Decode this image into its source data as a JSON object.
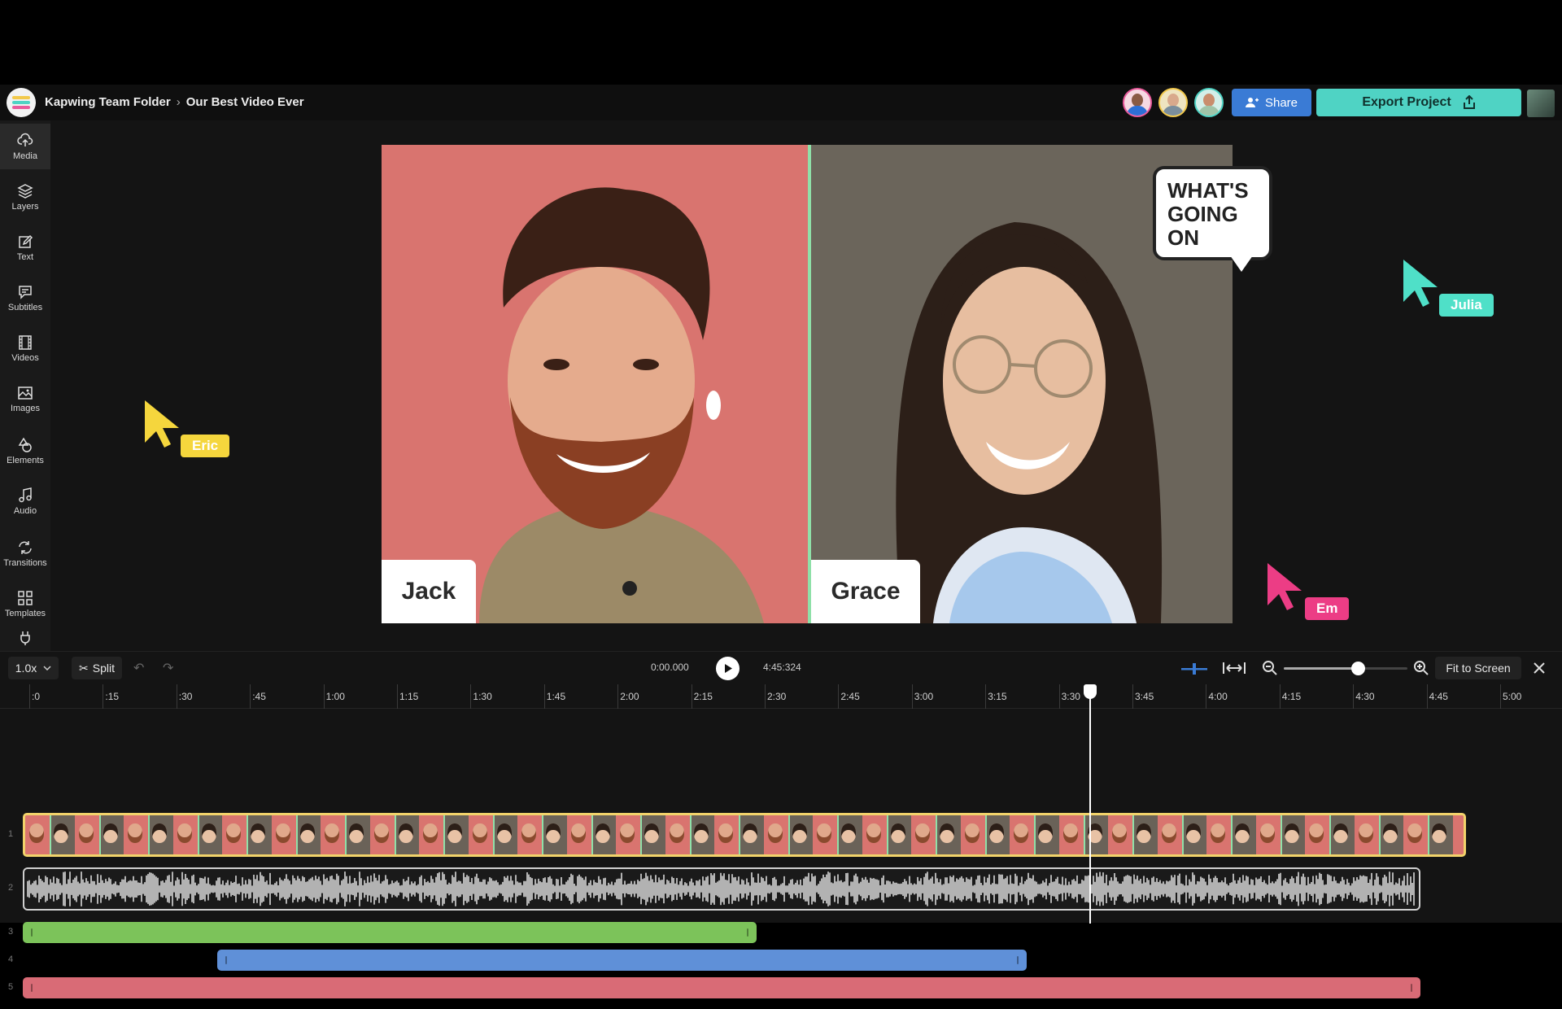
{
  "topbar": {
    "folder": "Kapwing Team Folder",
    "separator": "›",
    "project_title": "Our Best Video Ever",
    "share_label": "Share",
    "export_label": "Export Project",
    "collaborators": [
      {
        "name": "collaborator-1",
        "color": "#e85a9b",
        "body": "#2d6fd6"
      },
      {
        "name": "collaborator-2",
        "color": "#f2c94c",
        "body": "#7b8e9c"
      },
      {
        "name": "collaborator-3",
        "color": "#4fd3c4",
        "body": "#a0c4a8"
      }
    ]
  },
  "sidebar": {
    "items": [
      {
        "label": "Media",
        "icon": "upload-icon"
      },
      {
        "label": "Layers",
        "icon": "layers-icon"
      },
      {
        "label": "Text",
        "icon": "pencil-icon"
      },
      {
        "label": "Subtitles",
        "icon": "subtitles-icon"
      },
      {
        "label": "Videos",
        "icon": "film-icon"
      },
      {
        "label": "Images",
        "icon": "image-icon"
      },
      {
        "label": "Elements",
        "icon": "shapes-icon"
      },
      {
        "label": "Audio",
        "icon": "music-icon"
      },
      {
        "label": "Transitions",
        "icon": "transition-icon"
      },
      {
        "label": "Templates",
        "icon": "grid-icon"
      },
      {
        "label": "",
        "icon": "plugin-icon"
      }
    ]
  },
  "canvas": {
    "left_name": "Jack",
    "right_name": "Grace",
    "speech_bubble": [
      "WHAT'S",
      "GOING",
      "ON"
    ]
  },
  "cursors": [
    {
      "name": "Eric",
      "color": "#f5d63d"
    },
    {
      "name": "Julia",
      "color": "#4fe0c8"
    },
    {
      "name": "Em",
      "color": "#ec3d85"
    }
  ],
  "timeline": {
    "speed": "1.0x",
    "split_label": "Split",
    "current_time": "0:00.000",
    "total_time": "4:45:324",
    "fit_label": "Fit to Screen",
    "zoom_level": 0.6,
    "ruler": [
      ":0",
      ":15",
      ":30",
      ":45",
      "1:00",
      "1:15",
      "1:30",
      "1:45",
      "2:00",
      "2:15",
      "2:30",
      "2:45",
      "3:00",
      "3:15",
      "3:30",
      "3:45",
      "4:00",
      "4:15",
      "4:30",
      "4:45",
      "5:00"
    ],
    "rows": [
      "1",
      "2",
      "3",
      "4",
      "5"
    ],
    "track_colors": {
      "video": "#f2d36b",
      "green": "#7cc35a",
      "blue": "#5f90d8",
      "red": "#d96b76"
    }
  }
}
